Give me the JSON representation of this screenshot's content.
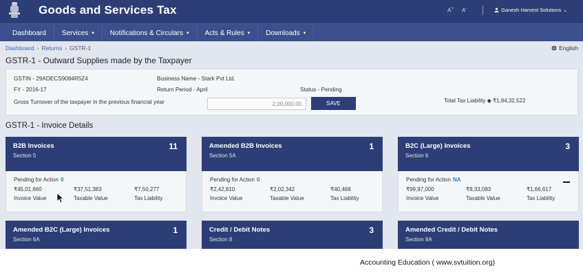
{
  "header": {
    "title": "Goods and Services Tax",
    "font_increase": "A",
    "font_decrease": "A",
    "user": "Ganesh Harvest Solutions",
    "emblem_icon": "emblem-icon",
    "user_icon": "user-icon",
    "bg_color": "#2d3e76"
  },
  "nav": {
    "items": [
      {
        "label": "Dashboard",
        "caret": ""
      },
      {
        "label": "Services",
        "caret": "▾"
      },
      {
        "label": "Notifications & Circulars",
        "caret": "▾"
      },
      {
        "label": "Acts & Rules",
        "caret": "▾"
      },
      {
        "label": "Downloads",
        "caret": "▾"
      }
    ]
  },
  "breadcrumb": {
    "items": [
      "Dashboard",
      "Returns",
      "GSTR-1"
    ],
    "separator": "›"
  },
  "language": "English",
  "page_title": "GSTR-1 - Outward Supplies made by the Taxpayer",
  "taxpayer": {
    "gstin": "GSTIN - 29ADECS9084R5Z4",
    "business_name": "Business Name - Stark Pvt Ltd.",
    "fy": "FY - 2016-17",
    "return_period": "Return Period - April",
    "status": "Status - Pending",
    "turnover_label": "Gross Turnover of the taxpayer in the previous financial year",
    "turnover_value": "2,00,000.00",
    "save_label": "SAVE",
    "liability_label": "Total Tax Liability",
    "liability_value": "₹1,84,32,522"
  },
  "section_title": "GSTR-1 - Invoice Details",
  "cards": [
    {
      "name": "B2B Invoices",
      "section": "Section 5",
      "count": "11",
      "pending_label": "Pending for Action",
      "pending_value": "0",
      "invoice_value": "₹45,01,660",
      "taxable_value": "₹37,51,383",
      "tax_liability": "₹7,50,277",
      "invoice_label": "Invoice Value",
      "taxable_label": "Taxable Value",
      "liability_label": "Tax Liability"
    },
    {
      "name": "Amended B2B Invoices",
      "section": "Section 5A",
      "count": "1",
      "pending_label": "Pending for Action",
      "pending_value": "0",
      "invoice_value": "₹2,42,810",
      "taxable_value": "₹2,02,342",
      "tax_liability": "₹40,468",
      "invoice_label": "Invoice Value",
      "taxable_label": "Taxable Value",
      "liability_label": "Tax Liability"
    },
    {
      "name": "B2C (Large) Invoices",
      "section": "Section 6",
      "count": "3",
      "pending_label": "Pending for Action",
      "pending_value": "NA",
      "invoice_value": "₹99,97,000",
      "taxable_value": "₹8,33,083",
      "tax_liability": "₹1,66,617",
      "invoice_label": "Invoice Value",
      "taxable_label": "Taxable Value",
      "liability_label": "Tax Liability"
    },
    {
      "name": "Amended B2C (Large) Invoices",
      "section": "Section 6A",
      "count": "1"
    },
    {
      "name": "Credit / Debit Notes",
      "section": "Section 8",
      "count": "3"
    },
    {
      "name": "Amended Credit / Debit Notes",
      "section": "Section 8A",
      "count": ""
    }
  ],
  "watermark": "Accounting Education ( www.svtuition.org)"
}
